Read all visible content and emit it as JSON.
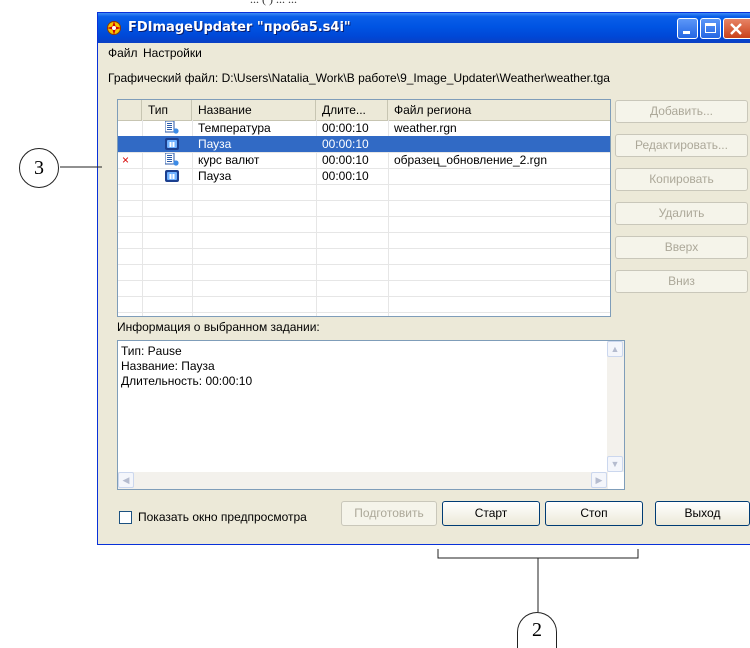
{
  "window": {
    "title": "FDImageUpdater \"проба5.s4i\""
  },
  "menu": [
    "Файл",
    "Настройки"
  ],
  "file_path": "Графический файл: D:\\Users\\Natalia_Work\\В работе\\9_Image_Updater\\Weather\\weather.tga",
  "list": {
    "columns": [
      "Тип",
      "Название",
      "Длите...",
      "Файл региона"
    ],
    "rows": [
      {
        "mark": "",
        "type_icon": "task-update-icon",
        "name": "Температура",
        "duration": "00:00:10",
        "region": "weather.rgn",
        "selected": false
      },
      {
        "mark": "",
        "type_icon": "pause-icon",
        "name": "Пауза",
        "duration": "00:00:10",
        "region": "",
        "selected": true
      },
      {
        "mark": "×",
        "type_icon": "task-update-icon",
        "name": "курс валют",
        "duration": "00:00:10",
        "region": "образец_обновление_2.rgn",
        "selected": false
      },
      {
        "mark": "",
        "type_icon": "pause-icon",
        "name": "Пауза",
        "duration": "00:00:10",
        "region": "",
        "selected": false
      }
    ]
  },
  "side_buttons": {
    "add": "Добавить...",
    "edit": "Редактировать...",
    "copy": "Копировать",
    "delete": "Удалить",
    "up": "Вверх",
    "down": "Вниз"
  },
  "info": {
    "label": "Информация о выбранном задании:",
    "lines": [
      "Тип: Pause",
      "Название: Пауза",
      "Длительность: 00:00:10"
    ]
  },
  "bottom": {
    "preview_label": "Показать окно предпросмотра",
    "prepare": "Подготовить",
    "start": "Старт",
    "stop": "Стоп",
    "exit": "Выход"
  },
  "callouts": {
    "left": "3",
    "bottom": "2"
  },
  "top_caption": "... ( ) ... ..."
}
